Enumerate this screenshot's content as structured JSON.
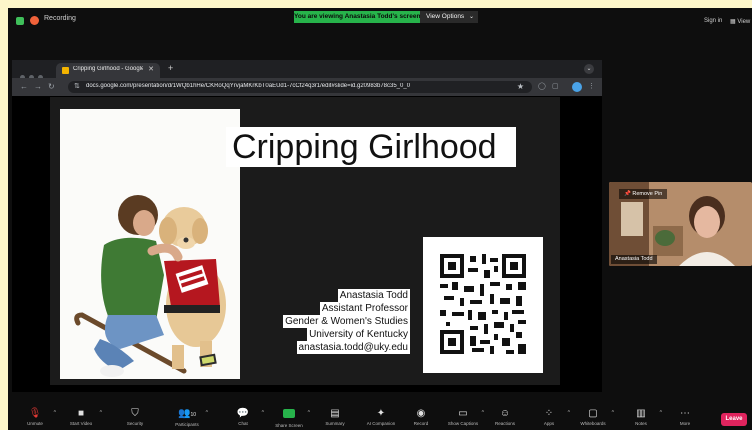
{
  "top_bar": {
    "recording_label": "Recording",
    "share_banner": "You are viewing Anastasia Todd's screen",
    "view_options_label": "View Options",
    "sign_in": "Sign in",
    "view_label": "View"
  },
  "browser": {
    "tab_title": "Cripping Girlhood - Google S",
    "url": "docs.google.com/presentation/d/1WQb1hHe/CKRoQqYrvjaMKrKbT0aEUd1-7cCf24q3r1/edit#slide=id.g20983b78c35_0_0"
  },
  "slide": {
    "title": "Cripping Girlhood",
    "author": {
      "name": "Anastasia Todd",
      "position": "Assistant Professor",
      "department": "Gender & Women's Studies",
      "institution": "University of Kentucky",
      "email": "anastasia.todd@uky.edu"
    }
  },
  "participant": {
    "remove_pin": "Remove Pin",
    "name": "Anastasia Todd"
  },
  "controls": {
    "unmute": "Unmute",
    "start_video": "Start Video",
    "security": "Security",
    "participants": "Participants",
    "participants_count": "10",
    "chat": "Chat",
    "share_screen": "Share Screen",
    "summary": "Summary",
    "ai_companion": "AI Companion",
    "record": "Record",
    "show_captions": "Show Captions",
    "reactions": "Reactions",
    "apps": "Apps",
    "whiteboards": "Whiteboards",
    "notes": "Notes",
    "more": "More",
    "leave": "Leave"
  }
}
